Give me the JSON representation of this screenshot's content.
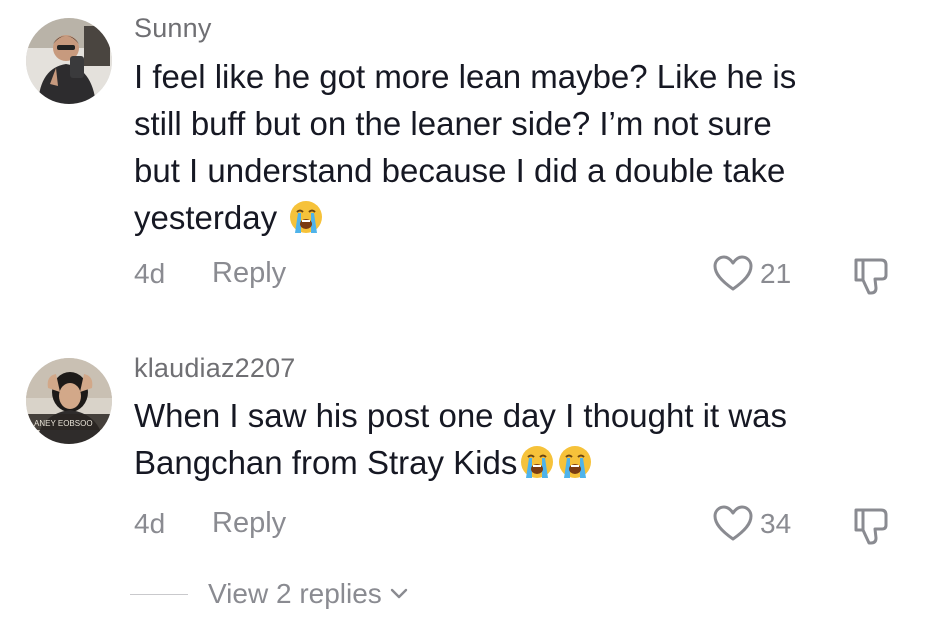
{
  "comments": [
    {
      "username": "Sunny",
      "text_lines": [
        "I feel like he got more lean maybe? Like he is",
        "still buff but on the leaner side? I’m not sure",
        "but I understand because I did a double take",
        "yesterday"
      ],
      "emojis": [
        "loudly-crying-face"
      ],
      "time": "4d",
      "reply_label": "Reply",
      "likes": "21"
    },
    {
      "username": "klaudiaz2207",
      "avatar_caption": "ANEY EOBSOO",
      "text_lines": [
        "When I saw his post one day I thought it was",
        "Bangchan from Stray Kids"
      ],
      "emojis": [
        "loudly-crying-face",
        "loudly-crying-face"
      ],
      "time": "4d",
      "reply_label": "Reply",
      "likes": "34"
    }
  ],
  "view_replies_label": "View 2 replies",
  "icons": {
    "like": "heart-icon",
    "dislike": "thumbs-down-icon",
    "expand": "chevron-down-icon"
  },
  "colors": {
    "text": "#161823",
    "muted": "#8a8b91",
    "username": "#6f6f73"
  }
}
